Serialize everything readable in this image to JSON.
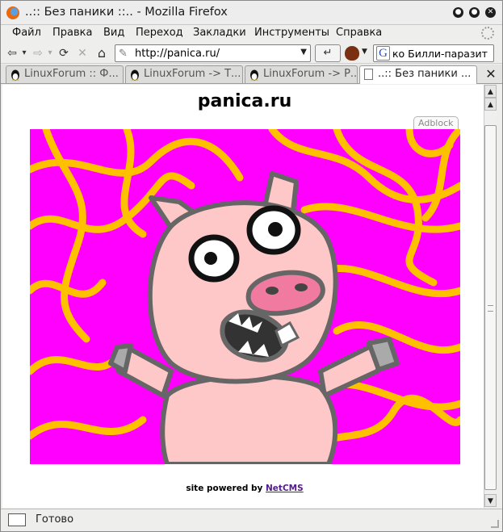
{
  "window": {
    "title": "..:: Без паники ::.. - Mozilla Firefox",
    "controls": {
      "minimize": "●",
      "maximize": "●",
      "close": "✕"
    }
  },
  "menu": {
    "items": [
      {
        "label": "Файл"
      },
      {
        "label": "Правка"
      },
      {
        "label": "Вид"
      },
      {
        "label": "Переход"
      },
      {
        "label": "Закладки"
      },
      {
        "label": "Инструменты"
      },
      {
        "label": "Справка"
      }
    ]
  },
  "toolbar": {
    "back": "⇦",
    "back_drop": "▾",
    "forward": "⇨",
    "forward_drop": "▾",
    "reload": "⟳",
    "stop": "✕",
    "home": "⌂",
    "url": "http://panica.ru/",
    "url_drop": "▼",
    "go": "↵",
    "search_value": "ко Билли-паразит",
    "search_engine_letter": "G"
  },
  "tabs": [
    {
      "label": "LinuxForum :: Ф...",
      "active": false
    },
    {
      "label": "LinuxForum -> Т...",
      "active": false
    },
    {
      "label": "LinuxForum -> Р...",
      "active": false
    },
    {
      "label": "..:: Без паники ...",
      "active": true
    }
  ],
  "tab_close": "✕",
  "page": {
    "title": "panica.ru",
    "adblock_label": "Adblock",
    "footer_prefix": "site powered by ",
    "footer_link": "NetCMS",
    "colors": {
      "background": "#ff00ff",
      "lines": "#ffc000",
      "pig": "#ffc8c8",
      "outline": "#666666",
      "snout": "#f07aa0"
    }
  },
  "scrollbar": {
    "up": "▲",
    "down": "▼"
  },
  "status": {
    "text": "Готово"
  }
}
